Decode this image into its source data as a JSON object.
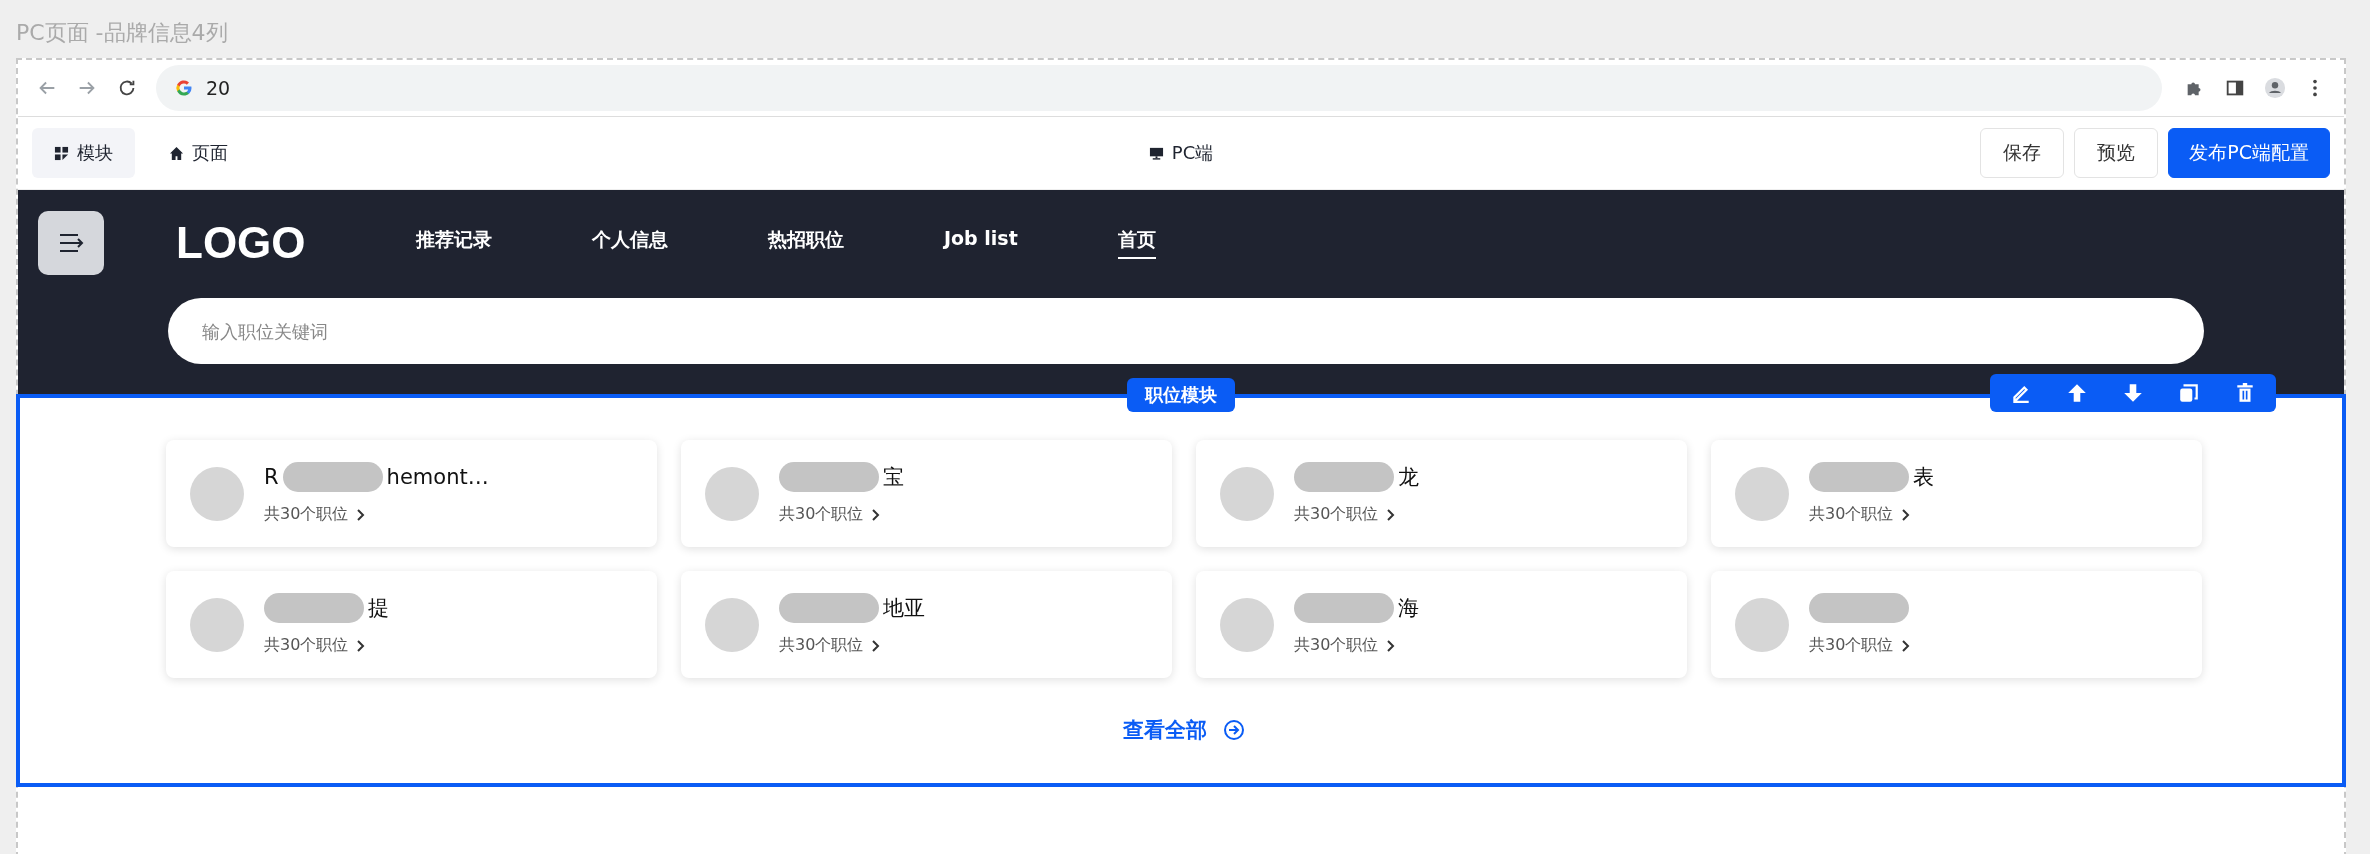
{
  "page_title": "PC页面 -品牌信息4列",
  "browser": {
    "address": "20"
  },
  "editor": {
    "tabs": [
      {
        "label": "模块",
        "selected": true
      },
      {
        "label": "页面",
        "selected": false
      }
    ],
    "device": "PC端",
    "buttons": [
      {
        "label": "保存",
        "kind": "plain"
      },
      {
        "label": "预览",
        "kind": "plain"
      },
      {
        "label": "发布PC端配置",
        "kind": "primary"
      }
    ]
  },
  "site": {
    "logo": "LOGO",
    "nav": [
      {
        "label": "推荐记录",
        "selected": false
      },
      {
        "label": "个人信息",
        "selected": false
      },
      {
        "label": "热招职位",
        "selected": false
      },
      {
        "label": "Job list",
        "selected": false
      },
      {
        "label": "首页",
        "selected": true
      }
    ],
    "search": {
      "placeholder": "输入职位关键词"
    }
  },
  "module": {
    "label": "职位模块",
    "brands": [
      {
        "name_start": "R",
        "name_end": "hemont…",
        "count": "共30个职位"
      },
      {
        "name_end": "宝",
        "count": "共30个职位"
      },
      {
        "name_end": "龙",
        "count": "共30个职位"
      },
      {
        "name_end": "表",
        "count": "共30个职位"
      },
      {
        "name_end": "提",
        "count": "共30个职位"
      },
      {
        "name_end": "地亚",
        "count": "共30个职位"
      },
      {
        "name_end": "海",
        "count": "共30个职位"
      },
      {
        "count": "共30个职位"
      }
    ],
    "view_all": "查看全部"
  }
}
